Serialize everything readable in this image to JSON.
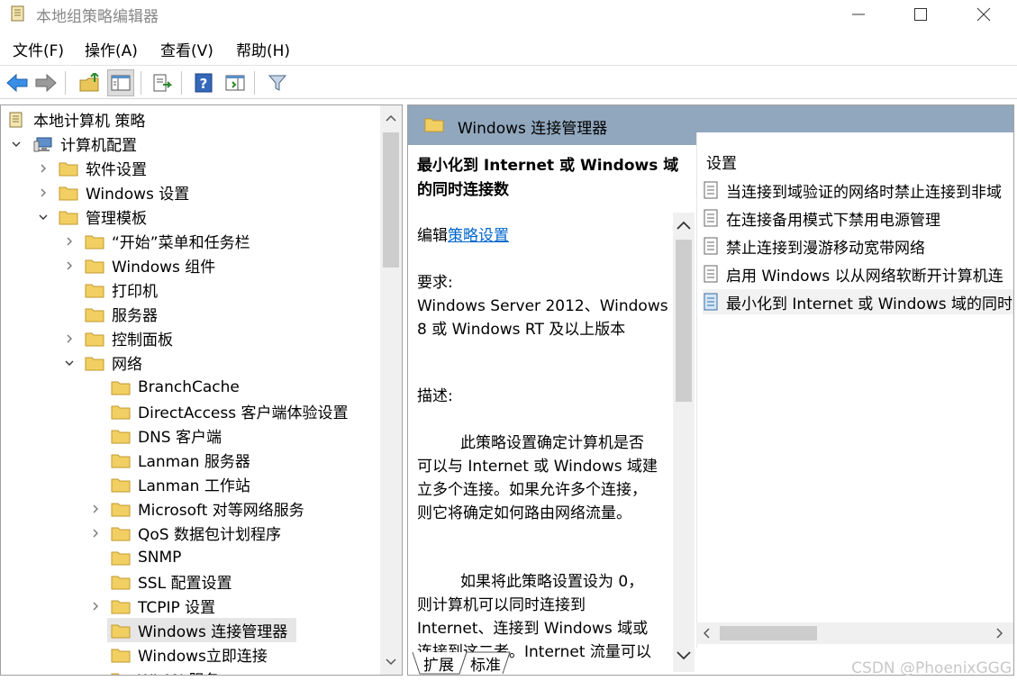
{
  "window": {
    "title": "本地组策略编辑器"
  },
  "menu": {
    "items": [
      "文件(F)",
      "操作(A)",
      "查看(V)",
      "帮助(H)"
    ]
  },
  "tree": {
    "items": [
      {
        "label": "本地计算机 策略",
        "icon": "policy-doc-icon"
      },
      {
        "label": "计算机配置",
        "icon": "computer-icon"
      },
      {
        "label": "软件设置"
      },
      {
        "label": "Windows 设置"
      },
      {
        "label": "管理模板"
      },
      {
        "label": "“开始”菜单和任务栏"
      },
      {
        "label": "Windows 组件"
      },
      {
        "label": "打印机"
      },
      {
        "label": "服务器"
      },
      {
        "label": "控制面板"
      },
      {
        "label": "网络"
      },
      {
        "label": "BranchCache"
      },
      {
        "label": "DirectAccess 客户端体验设置"
      },
      {
        "label": "DNS 客户端"
      },
      {
        "label": "Lanman 服务器"
      },
      {
        "label": "Lanman 工作站"
      },
      {
        "label": "Microsoft 对等网络服务"
      },
      {
        "label": "QoS 数据包计划程序"
      },
      {
        "label": "SNMP"
      },
      {
        "label": "SSL 配置设置"
      },
      {
        "label": "TCPIP 设置"
      },
      {
        "label": "Windows 连接管理器"
      },
      {
        "label": "Windows立即连接"
      },
      {
        "label": "WLAN 服务"
      }
    ]
  },
  "right": {
    "header": "Windows 连接管理器",
    "desc_title": "最小化到 Internet 或 Windows 域的同时连接数",
    "edit_prefix": "编辑",
    "edit_link": "策略设置",
    "req_label": "要求:",
    "req_text": "Windows Server 2012、Windows 8 或 Windows RT 及以上版本",
    "desc_label": "描述:",
    "desc_p1": "此策略设置确定计算机是否可以与 Internet 或 Windows 域建立多个连接。如果允许多个连接，则它将确定如何路由网络流量。",
    "desc_p2": "如果将此策略设置设为 0，则计算机可以同时连接到 Internet、连接到 Windows 域或连接到这二者。Internet 流量可以",
    "settings_header": "设置",
    "settings": [
      "当连接到域验证的网络时禁止连接到非域",
      "在连接备用模式下禁用电源管理",
      "禁止连接到漫游移动宽带网络",
      "启用 Windows 以从网络软断开计算机连",
      "最小化到 Internet 或 Windows 域的同时"
    ]
  },
  "tabs": [
    "扩展",
    "标准"
  ],
  "watermark": "CSDN @PhoenixGGG"
}
